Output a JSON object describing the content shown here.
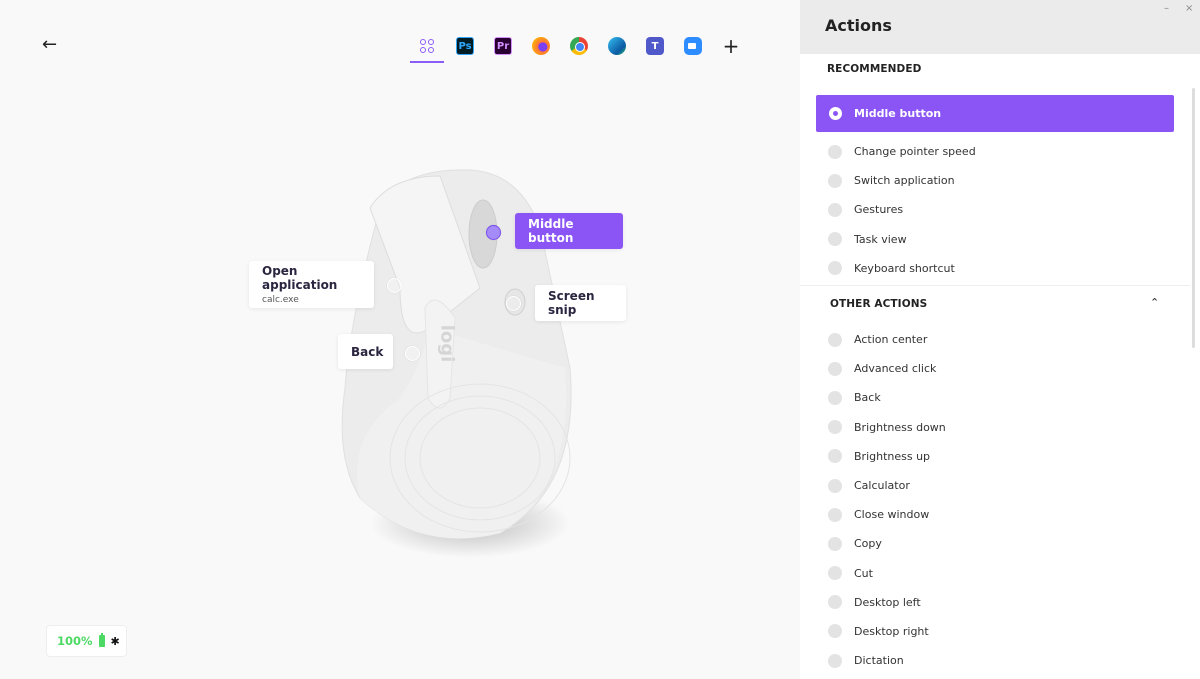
{
  "nav": {
    "back_icon": "←"
  },
  "apps": [
    {
      "name": "all-applications",
      "label": "",
      "active": true
    },
    {
      "name": "photoshop",
      "label": "Ps"
    },
    {
      "name": "premiere",
      "label": "Pr"
    },
    {
      "name": "firefox",
      "label": ""
    },
    {
      "name": "chrome",
      "label": ""
    },
    {
      "name": "edge",
      "label": ""
    },
    {
      "name": "teams",
      "label": "T"
    },
    {
      "name": "zoom",
      "label": ""
    },
    {
      "name": "add-application",
      "label": "+"
    }
  ],
  "callouts": {
    "middle": {
      "label": "Middle button"
    },
    "open_app": {
      "label": "Open application",
      "sub": "calc.exe"
    },
    "screen_snip": {
      "label": "Screen snip"
    },
    "back": {
      "label": "Back"
    }
  },
  "mouse_logo": "logi",
  "battery": {
    "percent": "100%",
    "bluetooth_icon": "✱"
  },
  "panel": {
    "title": "Actions",
    "minimize": "–",
    "close": "×",
    "recommended_header": "RECOMMENDED",
    "selected": "Middle button",
    "recommended": [
      "Change pointer speed",
      "Switch application",
      "Gestures",
      "Task view",
      "Keyboard shortcut"
    ],
    "other_header": "OTHER ACTIONS",
    "chevron": "⌃",
    "other": [
      "Action center",
      "Advanced click",
      "Back",
      "Brightness down",
      "Brightness up",
      "Calculator",
      "Close window",
      "Copy",
      "Cut",
      "Desktop left",
      "Desktop right",
      "Dictation"
    ]
  },
  "colors": {
    "accent": "#8b55f5",
    "battery": "#4cd964"
  }
}
